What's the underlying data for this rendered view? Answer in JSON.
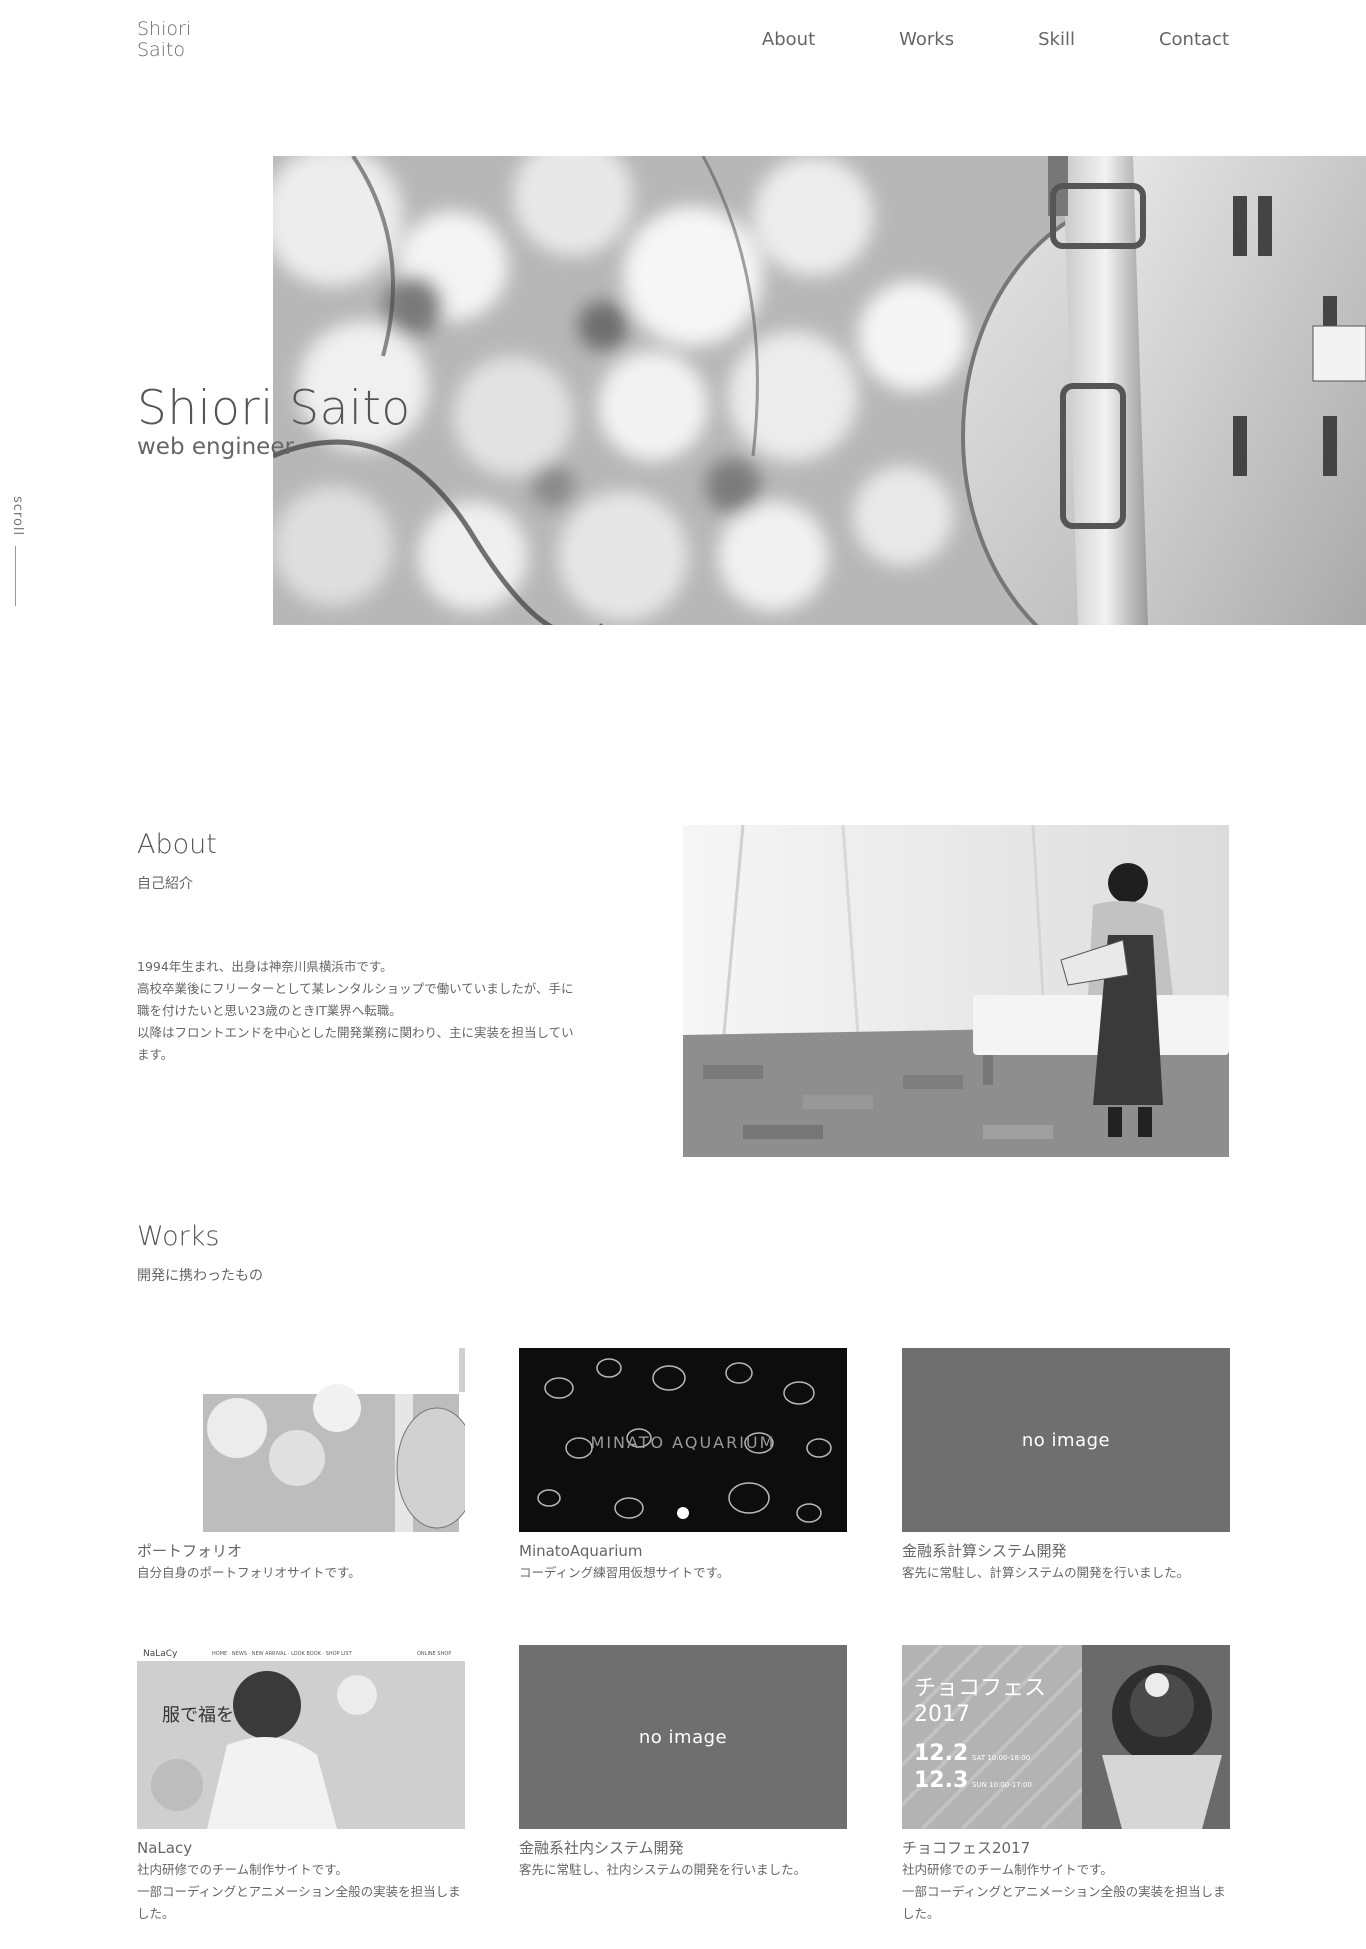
{
  "header": {
    "logo_line1": "Shiori",
    "logo_line2": "Saito",
    "nav": [
      "About",
      "Works",
      "Skill",
      "Contact"
    ]
  },
  "hero": {
    "title": "Shiori Saito",
    "subtitle": "web engineer",
    "scroll_label": "scroll"
  },
  "about": {
    "title": "About",
    "subtitle": "自己紹介",
    "lines": [
      "1994年生まれ、出身は神奈川県横浜市です。",
      "高校卒業後にフリーターとして某レンタルショップで働いていましたが、手に職を付けたいと思い23歳のときIT業界へ転職。",
      "以降はフロントエンドを中心とした開発業務に関わり、主に実装を担当しています。"
    ]
  },
  "works": {
    "title": "Works",
    "subtitle": "開発に携わったもの",
    "no_image_label": "no image",
    "items": [
      {
        "name": "ポートフォリオ",
        "desc": "自分自身のポートフォリオサイトです。"
      },
      {
        "name": "MinatoAquarium",
        "desc": "コーディング練習用仮想サイトです。",
        "thumb_text": "MINATO AQUARIUM"
      },
      {
        "name": "金融系計算システム開発",
        "desc": "客先に常駐し、計算システムの開発を行いました。"
      },
      {
        "name": "NaLacy",
        "desc": "社内研修でのチーム制作サイトです。\n一部コーディングとアニメーション全般の実装を担当しました。",
        "thumb_logo": "NaLaCy",
        "thumb_menu": "HOME · NEWS · NEW ARRIVAL · LOOK BOOK · SHOP LIST",
        "thumb_shop": "ONLINE SHOP",
        "thumb_copy": "服で福を"
      },
      {
        "name": "金融系社内システム開発",
        "desc": "客先に常駐し、社内システムの開発を行いました。"
      },
      {
        "name": "チョコフェス2017",
        "desc": "社内研修でのチーム制作サイトです。\n一部コーディングとアニメーション全般の実装を担当しました。",
        "thumb_title1": "チョコフェス",
        "thumb_title2": "2017",
        "thumb_date1": "12.2",
        "thumb_time1": "SAT 10:00-18:00",
        "thumb_date2": "12.3",
        "thumb_time2": "SUN 10:00-17:00"
      }
    ]
  }
}
